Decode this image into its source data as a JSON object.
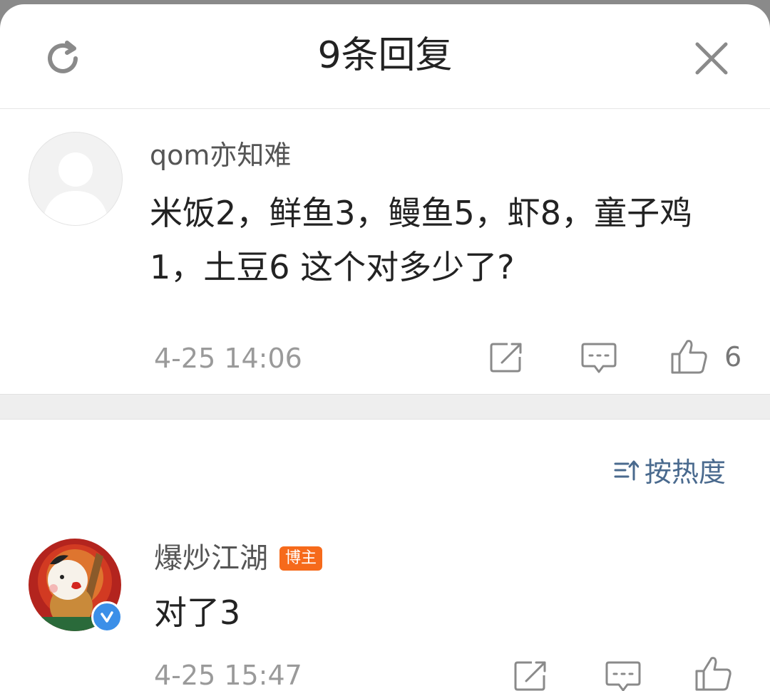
{
  "header": {
    "title": "9条回复",
    "refresh_icon": "refresh-icon",
    "close_icon": "close-icon"
  },
  "main_comment": {
    "username": "qom亦知难",
    "text": "米饭2，鲜鱼3，鳗鱼5，虾8，童子鸡1，土豆6 这个对多少了?",
    "timestamp": "4-25 14:06",
    "like_count": "6",
    "icons": [
      "share-icon",
      "comment-icon",
      "like-icon"
    ]
  },
  "sort": {
    "label": "按热度",
    "icon": "sort-icon"
  },
  "reply": {
    "username": "爆炒江湖",
    "badge": "博主",
    "text": "对了3",
    "timestamp": "4-25 15:47",
    "verified_icon": "verified-icon",
    "icons": [
      "share-icon",
      "comment-icon",
      "like-icon"
    ]
  },
  "colors": {
    "text_primary": "#222222",
    "text_secondary": "#555555",
    "text_muted": "#9a9a9a",
    "link_blue": "#4a6a8e",
    "badge_orange": "#f66a1b",
    "verified_blue": "#3b8fe8",
    "icon_gray": "#8a8a8a"
  }
}
